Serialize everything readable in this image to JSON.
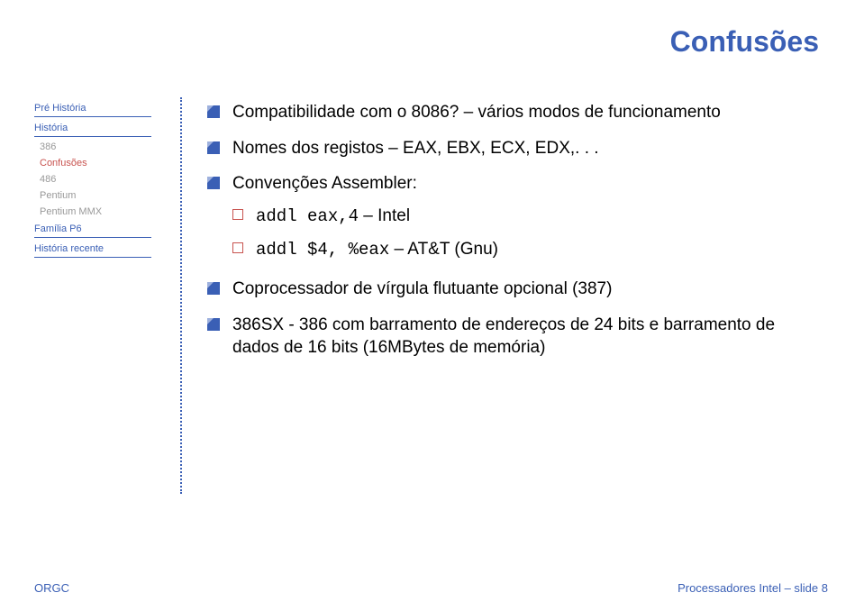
{
  "title": "Confusões",
  "sidebar": {
    "sections": [
      {
        "label": "Pré História",
        "items": []
      },
      {
        "label": "História",
        "items": [
          {
            "label": "386",
            "current": false
          },
          {
            "label": "Confusões",
            "current": true
          },
          {
            "label": "486",
            "current": false
          },
          {
            "label": "Pentium",
            "current": false
          },
          {
            "label": "Pentium MMX",
            "current": false
          }
        ]
      },
      {
        "label": "Família P6",
        "items": []
      },
      {
        "label": "História recente",
        "items": []
      }
    ]
  },
  "bullets": {
    "b1": "Compatibilidade com o 8086? – vários modos de funcionamento",
    "b2": "Nomes dos registos – EAX, EBX, ECX, EDX,. . .",
    "b3": "Convenções Assembler:",
    "b3s1_code": "addl eax,4",
    "b3s1_txt": " – Intel",
    "b3s2_code": "addl $4, %eax",
    "b3s2_txt": " – AT&T (Gnu)",
    "b4": "Coprocessador de vírgula flutuante opcional (387)",
    "b5": "386SX - 386 com barramento de endereços de 24 bits e barramento de dados de 16 bits (16MBytes de memória)"
  },
  "footer": {
    "left": "ORGC",
    "right": "Processadores Intel – slide 8"
  }
}
